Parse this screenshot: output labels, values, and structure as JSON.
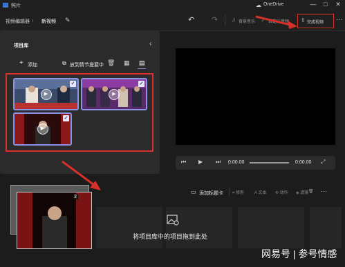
{
  "window": {
    "title": "照片",
    "cloud_label": "OneDrive",
    "minimize": "—",
    "maximize": "□",
    "close": "✕"
  },
  "toolbar": {
    "breadcrumb_root": "视频编辑器",
    "breadcrumb_sep": "›",
    "breadcrumb_current": "新视频",
    "background_music": "背景音乐",
    "custom_audio": "自定义音频",
    "finish_video": "完成视频",
    "more": "···"
  },
  "library": {
    "title": "项目库",
    "add": "添加",
    "place_in_storyboard": "放到情节提要中"
  },
  "player": {
    "current_time": "0:00.00",
    "total_time": "0:00.00"
  },
  "storyboard": {
    "add_title_card": "添加标题卡",
    "tools": [
      "修剪",
      "文本",
      "动作",
      "滤镜"
    ],
    "drop_hint": "将项目库中的项目拖到此处",
    "drag_count": "3"
  },
  "watermark": "网易号 | 参号情感",
  "colors": {
    "accent_highlight": "#d8302a",
    "selection": "#8b95e6",
    "background": "#1c1c1c",
    "panel": "#2b2b2b"
  },
  "icons": [
    "app-icon",
    "cloud-icon",
    "rename-icon",
    "undo-icon",
    "redo-icon",
    "music-icon",
    "audio-icon",
    "export-icon",
    "more-icon",
    "add-icon",
    "storyboard-icon",
    "delete-icon",
    "grid-icon",
    "list-icon",
    "play-icon",
    "check-icon"
  ]
}
